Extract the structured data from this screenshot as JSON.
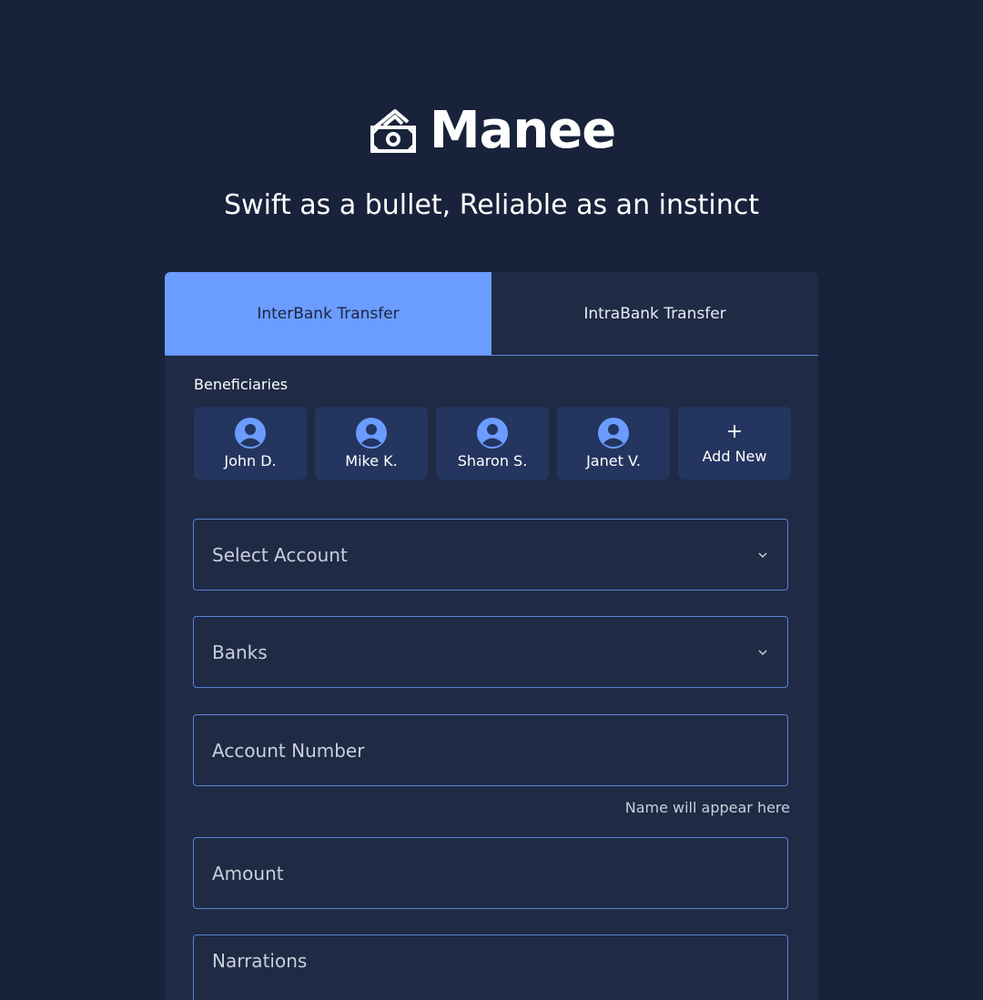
{
  "brand": {
    "name": "Manee",
    "tagline": "Swift as a bullet, Reliable as an instinct",
    "icon": "money-cash-icon"
  },
  "tabs": [
    {
      "label": "InterBank Transfer",
      "active": true
    },
    {
      "label": "IntraBank Transfer",
      "active": false
    }
  ],
  "beneficiaries": {
    "label": "Beneficiaries",
    "items": [
      {
        "name": "John D."
      },
      {
        "name": "Mike K."
      },
      {
        "name": "Sharon S."
      },
      {
        "name": "Janet V."
      }
    ],
    "add_new": {
      "symbol": "+",
      "label": "Add New"
    }
  },
  "form": {
    "select_account": "Select Account",
    "banks": "Banks",
    "account_number": "Account Number",
    "name_hint": "Name will appear here",
    "amount": "Amount",
    "narrations": "Narrations"
  },
  "colors": {
    "background": "#18223a",
    "card": "#1f2a45",
    "accent": "#6b9cff",
    "chip": "#24355f",
    "border": "#5b82d6"
  }
}
